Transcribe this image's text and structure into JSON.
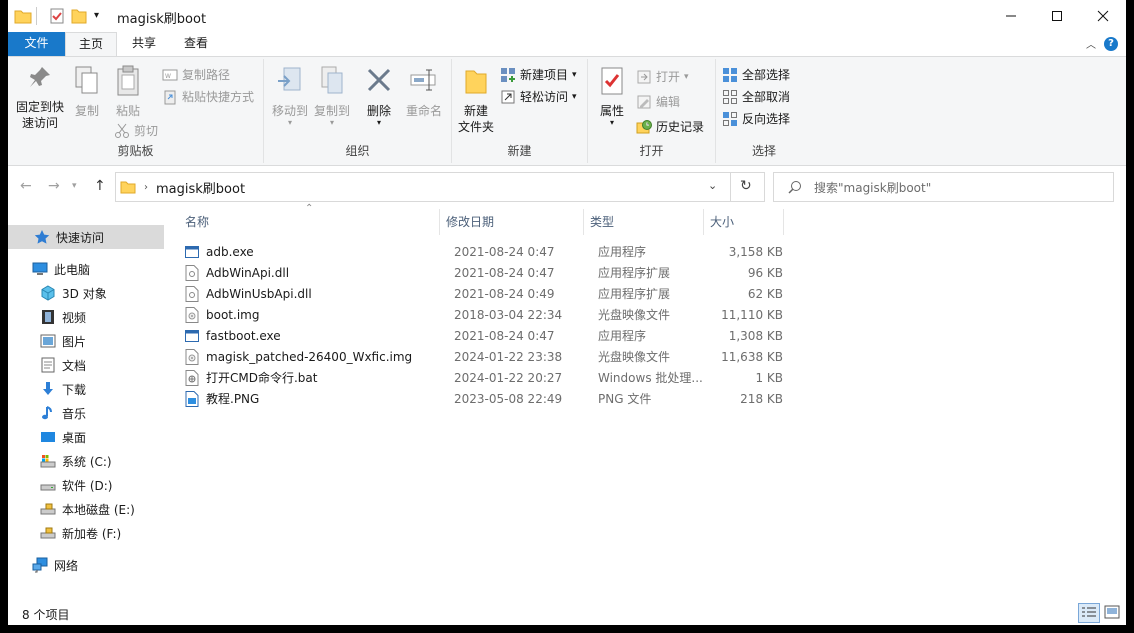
{
  "window": {
    "title": "magisk刷boot"
  },
  "tabs": {
    "file": "文件",
    "home": "主页",
    "share": "共享",
    "view": "查看"
  },
  "ribbon": {
    "clipboard": {
      "label": "剪贴板",
      "pin_quick": "固定到快速访问",
      "pin_line1": "固定到快",
      "pin_line2": "速访问",
      "copy": "复制",
      "paste": "粘贴",
      "copy_path": "复制路径",
      "paste_shortcut": "粘贴快捷方式",
      "cut": "剪切"
    },
    "organize": {
      "label": "组织",
      "move_to": "移动到",
      "copy_to": "复制到",
      "delete": "删除",
      "rename": "重命名"
    },
    "new": {
      "label": "新建",
      "new_folder_line1": "新建",
      "new_folder_line2": "文件夹",
      "new_item": "新建项目",
      "easy_access": "轻松访问"
    },
    "open": {
      "label": "打开",
      "properties": "属性",
      "open": "打开",
      "edit": "编辑",
      "history": "历史记录"
    },
    "select": {
      "label": "选择",
      "select_all": "全部选择",
      "select_none": "全部取消",
      "invert": "反向选择"
    }
  },
  "address": {
    "path": "magisk刷boot",
    "search_placeholder": "搜索\"magisk刷boot\""
  },
  "nav": {
    "quick_access": "快速访问",
    "this_pc": "此电脑",
    "objects_3d": "3D 对象",
    "videos": "视频",
    "pictures": "图片",
    "documents": "文档",
    "downloads": "下载",
    "music": "音乐",
    "desktop": "桌面",
    "drive_c": "系统 (C:)",
    "drive_d": "软件 (D:)",
    "drive_e": "本地磁盘 (E:)",
    "drive_f": "新加卷 (F:)",
    "network": "网络"
  },
  "columns": {
    "name": "名称",
    "date": "修改日期",
    "type": "类型",
    "size": "大小"
  },
  "files": [
    {
      "name": "adb.exe",
      "date": "2021-08-24 0:47",
      "type": "应用程序",
      "size": "3,158 KB",
      "icon": "exe-icon"
    },
    {
      "name": "AdbWinApi.dll",
      "date": "2021-08-24 0:47",
      "type": "应用程序扩展",
      "size": "96 KB",
      "icon": "dll-icon"
    },
    {
      "name": "AdbWinUsbApi.dll",
      "date": "2021-08-24 0:49",
      "type": "应用程序扩展",
      "size": "62 KB",
      "icon": "dll-icon"
    },
    {
      "name": "boot.img",
      "date": "2018-03-04 22:34",
      "type": "光盘映像文件",
      "size": "11,110 KB",
      "icon": "img-icon"
    },
    {
      "name": "fastboot.exe",
      "date": "2021-08-24 0:47",
      "type": "应用程序",
      "size": "1,308 KB",
      "icon": "exe-icon"
    },
    {
      "name": "magisk_patched-26400_Wxfic.img",
      "date": "2024-01-22 23:38",
      "type": "光盘映像文件",
      "size": "11,638 KB",
      "icon": "img-icon"
    },
    {
      "name": "打开CMD命令行.bat",
      "date": "2024-01-22 20:27",
      "type": "Windows 批处理...",
      "size": "1 KB",
      "icon": "bat-icon"
    },
    {
      "name": "教程.PNG",
      "date": "2023-05-08 22:49",
      "type": "PNG 文件",
      "size": "218 KB",
      "icon": "png-icon"
    }
  ],
  "status": {
    "count": "8 个项目"
  }
}
